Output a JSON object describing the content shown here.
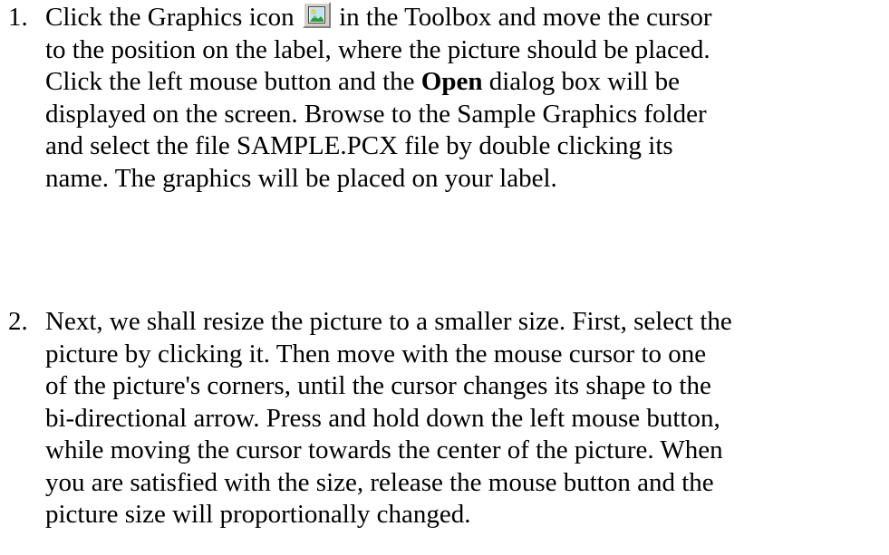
{
  "steps": [
    {
      "number": "1.",
      "lines": {
        "l1_a": "Click the Graphics icon",
        "l1_b": "in the Toolbox and move the cursor",
        "l2": "to the position on the label, where the picture should be placed.",
        "l3_a": "Click the left mouse button and the",
        "l3_bold": "Open",
        "l3_b": "dialog box will be",
        "l4": "displayed on the screen. Browse to the Sample Graphics folder",
        "l5": "and select the file SAMPLE.PCX file by double clicking its",
        "l6": "name. The graphics will be placed on your label."
      }
    },
    {
      "number": "2.",
      "lines": {
        "l1": "Next, we shall resize the picture to a smaller size. First, select the",
        "l2": "picture by clicking it. Then move with the mouse cursor to one",
        "l3": "of the picture's corners, until the cursor changes its shape to the",
        "l4": "bi-directional arrow. Press and hold down the left mouse button,",
        "l5": "while moving the cursor towards the center of the picture. When",
        "l6": "you are satisfied with the size, release the mouse button and the",
        "l7": "picture size will proportionally changed."
      }
    }
  ],
  "icons": {
    "graphics_icon": "picture-icon"
  },
  "colors": {
    "text": "#000000",
    "background": "#ffffff",
    "icon_face": "#d4d0c8"
  }
}
